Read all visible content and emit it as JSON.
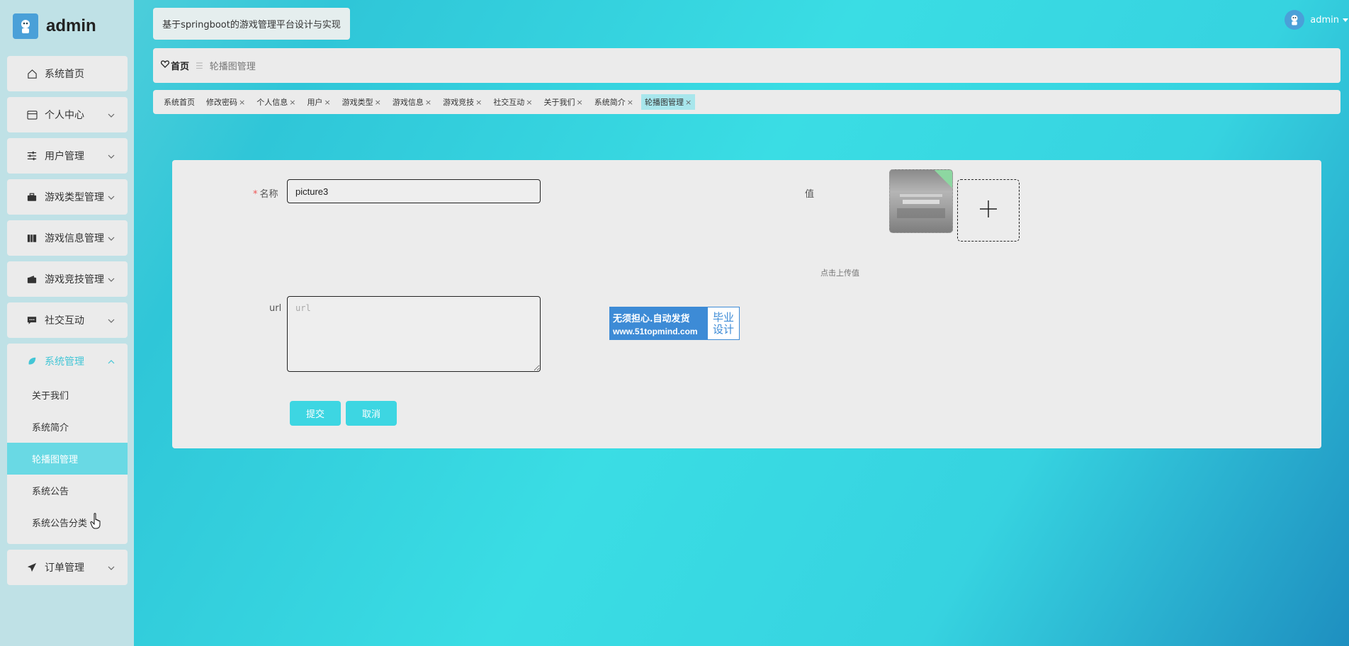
{
  "app": {
    "brand": "admin",
    "site_title": "基于springboot的游戏管理平台设计与实现",
    "username": "admin"
  },
  "sidebar": {
    "items": [
      {
        "label": "系统首页",
        "icon": "home-icon"
      },
      {
        "label": "个人中心",
        "icon": "card-icon"
      },
      {
        "label": "用户管理",
        "icon": "sliders-icon"
      },
      {
        "label": "游戏类型管理",
        "icon": "briefcase-icon"
      },
      {
        "label": "游戏信息管理",
        "icon": "books-icon"
      },
      {
        "label": "游戏竞技管理",
        "icon": "wallet-icon"
      },
      {
        "label": "社交互动",
        "icon": "chat-icon"
      },
      {
        "label": "系统管理",
        "icon": "leaf-icon"
      },
      {
        "label": "订单管理",
        "icon": "paper-plane-icon"
      }
    ],
    "sub_items": [
      "关于我们",
      "系统简介",
      "轮播图管理",
      "系统公告",
      "系统公告分类"
    ],
    "accent_color": "#43c6d6"
  },
  "breadcrumb": {
    "home": "首页",
    "current": "轮播图管理"
  },
  "tabs": [
    {
      "label": "系统首页",
      "closable": false
    },
    {
      "label": "修改密码",
      "closable": true
    },
    {
      "label": "个人信息",
      "closable": true
    },
    {
      "label": "用户",
      "closable": true
    },
    {
      "label": "游戏类型",
      "closable": true
    },
    {
      "label": "游戏信息",
      "closable": true
    },
    {
      "label": "游戏竞技",
      "closable": true
    },
    {
      "label": "社交互动",
      "closable": true
    },
    {
      "label": "关于我们",
      "closable": true
    },
    {
      "label": "系统简介",
      "closable": true
    },
    {
      "label": "轮播图管理",
      "closable": true
    }
  ],
  "form": {
    "name_label": "名称",
    "name_value": "picture3",
    "value_label": "值",
    "upload_hint": "点击上传值",
    "url_label": "url",
    "url_placeholder": "url",
    "submit": "提交",
    "cancel": "取消"
  },
  "watermark": {
    "line1": "无须担心.自动发货",
    "line2": "www.51topmind.com",
    "side1": "毕业",
    "side2": "设计"
  }
}
